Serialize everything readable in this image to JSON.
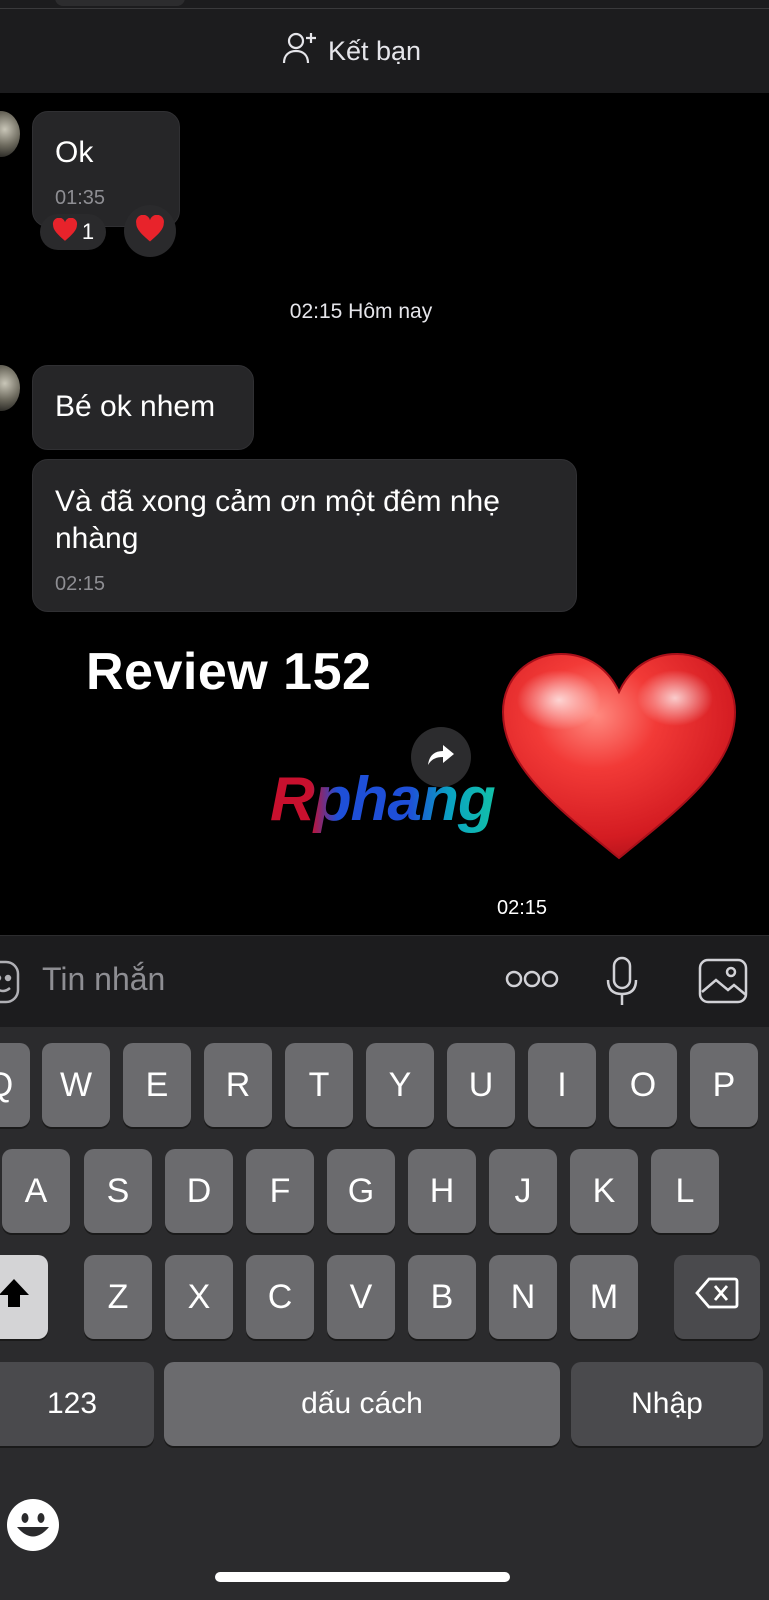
{
  "header": {
    "add_friend_label": "Kết bạn"
  },
  "messages": [
    {
      "text": "Ok",
      "time": "01:35",
      "reaction_count": "1"
    }
  ],
  "date_separator": "02:15 Hôm nay",
  "messages2": [
    {
      "text": "Bé ok nhem"
    },
    {
      "text_line1": "Và đã xong cảm ơn một đêm nhẹ",
      "text_line2": "nhàng",
      "time": "02:15"
    }
  ],
  "sticker": {
    "title": "Review 152",
    "logo": "Rphang",
    "time": "02:15",
    "heart_color": "#e8232b"
  },
  "composer": {
    "placeholder": "Tin nhắn"
  },
  "keyboard": {
    "row1": [
      "Q",
      "W",
      "E",
      "R",
      "T",
      "Y",
      "U",
      "I",
      "O",
      "P"
    ],
    "row2": [
      "A",
      "S",
      "D",
      "F",
      "G",
      "H",
      "J",
      "K",
      "L"
    ],
    "row3": [
      "Z",
      "X",
      "C",
      "V",
      "B",
      "N",
      "M"
    ],
    "numbers_key": "123",
    "space_key": "dấu cách",
    "return_key": "Nhập"
  },
  "colors": {
    "bubble": "#262628",
    "keyboard_bg": "#2b2b2d",
    "key": "#6b6b6e"
  }
}
